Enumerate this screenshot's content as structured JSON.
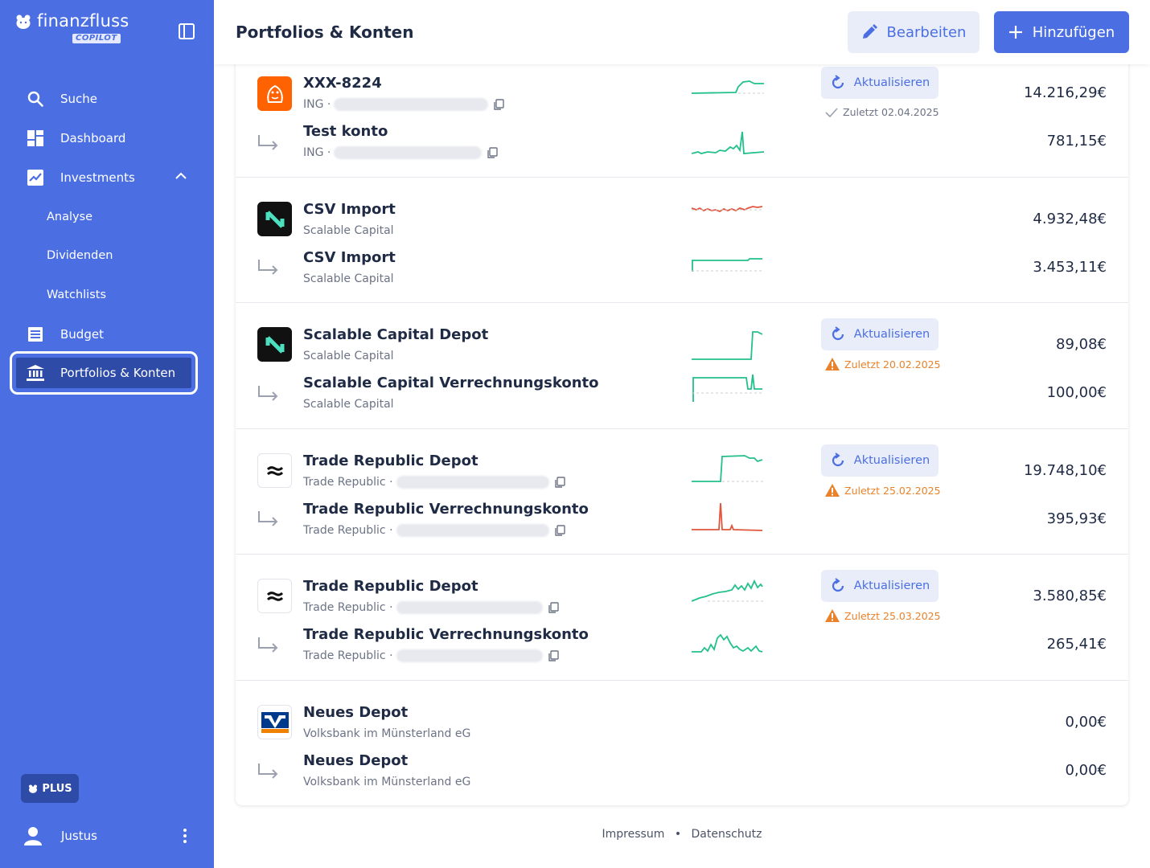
{
  "app": {
    "brand_name": "finanzfluss",
    "brand_sub": "COPILOT"
  },
  "sidebar": {
    "items": [
      {
        "label": "Suche",
        "icon": "search-icon"
      },
      {
        "label": "Dashboard",
        "icon": "dashboard-icon"
      },
      {
        "label": "Investments",
        "icon": "chart-line-icon"
      },
      {
        "label": "Budget",
        "icon": "list-icon"
      },
      {
        "label": "Portfolios & Konten",
        "icon": "bank-icon"
      }
    ],
    "subitems": [
      "Analyse",
      "Dividenden",
      "Watchlists"
    ],
    "plus_label": "PLUS",
    "user_name": "Justus"
  },
  "header": {
    "title": "Portfolios & Konten",
    "edit_label": "Bearbeiten",
    "add_label": "Hinzufügen"
  },
  "refresh_label": "Aktualisieren",
  "groups": [
    {
      "logo": "ing",
      "accounts": [
        {
          "name": "XXX-8224",
          "sub": "ING ·",
          "amount": "14.216,29€"
        },
        {
          "name": "Test konto",
          "sub": "ING ·",
          "amount": "781,15€"
        }
      ],
      "status": "Zuletzt 02.04.2025",
      "status_type": "ok"
    },
    {
      "logo": "scalable",
      "accounts": [
        {
          "name": "CSV Import",
          "sub": "Scalable Capital",
          "amount": "4.932,48€"
        },
        {
          "name": "CSV Import",
          "sub": "Scalable Capital",
          "amount": "3.453,11€"
        }
      ]
    },
    {
      "logo": "scalable",
      "accounts": [
        {
          "name": "Scalable Capital Depot",
          "sub": "Scalable Capital",
          "amount": "89,08€"
        },
        {
          "name": "Scalable Capital Verrechnungskonto",
          "sub": "Scalable Capital",
          "amount": "100,00€"
        }
      ],
      "status": "Zuletzt 20.02.2025",
      "status_type": "warn"
    },
    {
      "logo": "trade-republic",
      "accounts": [
        {
          "name": "Trade Republic Depot",
          "sub": "Trade Republic ·",
          "amount": "19.748,10€"
        },
        {
          "name": "Trade Republic Verrechnungskonto",
          "sub": "Trade Republic ·",
          "amount": "395,93€"
        }
      ],
      "status": "Zuletzt 25.02.2025",
      "status_type": "warn"
    },
    {
      "logo": "trade-republic",
      "accounts": [
        {
          "name": "Trade Republic Depot",
          "sub": "Trade Republic ·",
          "amount": "3.580,85€"
        },
        {
          "name": "Trade Republic Verrechnungskonto",
          "sub": "Trade Republic ·",
          "amount": "265,41€"
        }
      ],
      "status": "Zuletzt 25.03.2025",
      "status_type": "warn"
    },
    {
      "logo": "volksbank",
      "accounts": [
        {
          "name": "Neues Depot",
          "sub": "Volksbank im Münsterland eG",
          "amount": "0,00€"
        },
        {
          "name": "Neues Depot",
          "sub": "Volksbank im Münsterland eG",
          "amount": "0,00€"
        }
      ]
    }
  ],
  "footer": {
    "impressum": "Impressum",
    "separator": "•",
    "datenschutz": "Datenschutz"
  },
  "colors": {
    "sidebar": "#4b6fe3",
    "accent": "#4b6fe3",
    "spark_green": "#22c08a",
    "spark_red": "#e0553c",
    "warn": "#e9822b"
  }
}
